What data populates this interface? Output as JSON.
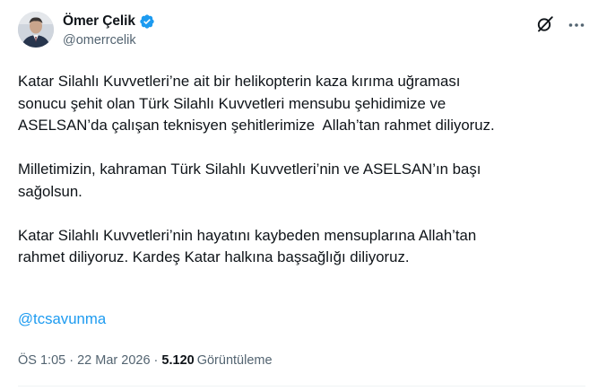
{
  "author": {
    "display_name": "Ömer Çelik",
    "handle": "@omerrcelik",
    "verified": true
  },
  "tweet": {
    "paragraphs": [
      "Katar Silahlı Kuvvetleri’ne ait bir helikopterin kaza kırıma uğraması\nsonucu şehit olan Türk Silahlı Kuvvetleri mensubu şehidimize ve\nASELSAN’da çalışan teknisyen şehitlerimize  Allah’tan rahmet diliyoruz.",
      "Milletimizin, kahraman Türk Silahlı Kuvvetleri’nin ve ASELSAN’ın başı\nsağolsun.",
      "Katar Silahlı Kuvvetleri’nin hayatını kaybeden mensuplarına Allah’tan\nrahmet diliyoruz. Kardeş Katar halkına başsağlığı diliyoruz."
    ],
    "mention": "@tcsavunma"
  },
  "meta": {
    "time": "ÖS 1:05",
    "separator": " · ",
    "date": "22 Mar 2026",
    "views_count": "5.120",
    "views_label": "Görüntüleme"
  },
  "icons": {
    "verified": "verified-badge-icon",
    "grok": "grok-icon",
    "more": "more-options-icon"
  },
  "colors": {
    "accent": "#1d9bf0",
    "text": "#0f1419",
    "secondary": "#536471"
  }
}
